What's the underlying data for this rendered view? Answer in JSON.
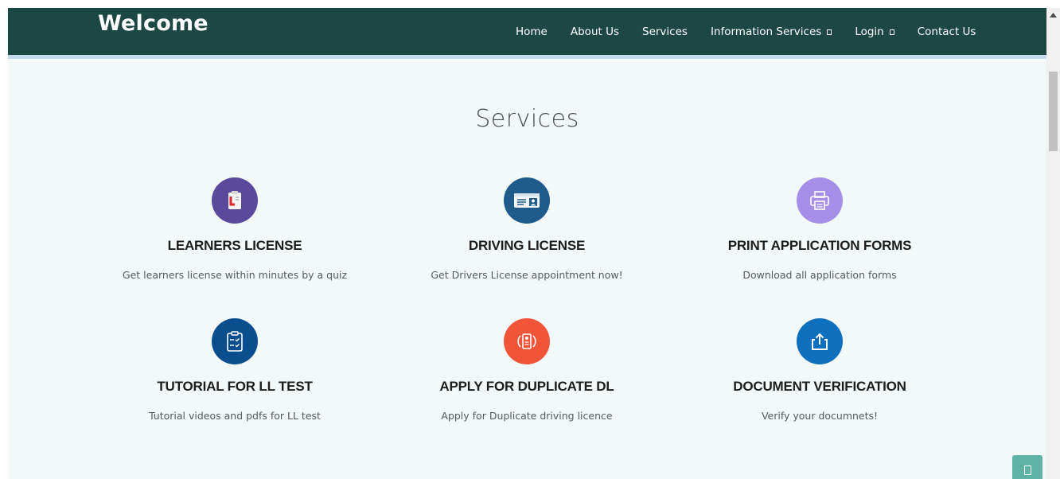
{
  "header": {
    "brand": "Welcome",
    "nav": [
      {
        "label": "Home",
        "dropdown": false
      },
      {
        "label": "About Us",
        "dropdown": false
      },
      {
        "label": "Services",
        "dropdown": false,
        "active": true
      },
      {
        "label": "Information Services",
        "dropdown": true
      },
      {
        "label": "Login",
        "dropdown": true
      },
      {
        "label": "Contact Us",
        "dropdown": false
      }
    ]
  },
  "section": {
    "title": "Services"
  },
  "services": [
    {
      "title": "LEARNERS LICENSE",
      "desc": "Get learners license within minutes by a quiz",
      "icon": "learner-clipboard-icon",
      "color": "#5b4a9b"
    },
    {
      "title": "DRIVING LICENSE",
      "desc": "Get Drivers License appointment now!",
      "icon": "id-card-icon",
      "color": "#1e5b8b"
    },
    {
      "title": "PRINT APPLICATION FORMS",
      "desc": "Download all application forms",
      "icon": "printer-icon",
      "color": "#a58ee8"
    },
    {
      "title": "TUTORIAL FOR LL TEST",
      "desc": "Tutorial videos and pdfs for LL test",
      "icon": "checklist-icon",
      "color": "#0b4e8e"
    },
    {
      "title": "APPLY FOR DUPLICATE DL",
      "desc": "Apply for Duplicate driving licence",
      "icon": "duplicate-card-icon",
      "color": "#f0553a"
    },
    {
      "title": "DOCUMENT VERIFICATION",
      "desc": "Verify your documnets!",
      "icon": "upload-icon",
      "color": "#0f6fbf"
    }
  ],
  "colors": {
    "navbar": "#1d4743",
    "background": "#f3f8f8",
    "back_to_top": "#5fb3a4"
  }
}
